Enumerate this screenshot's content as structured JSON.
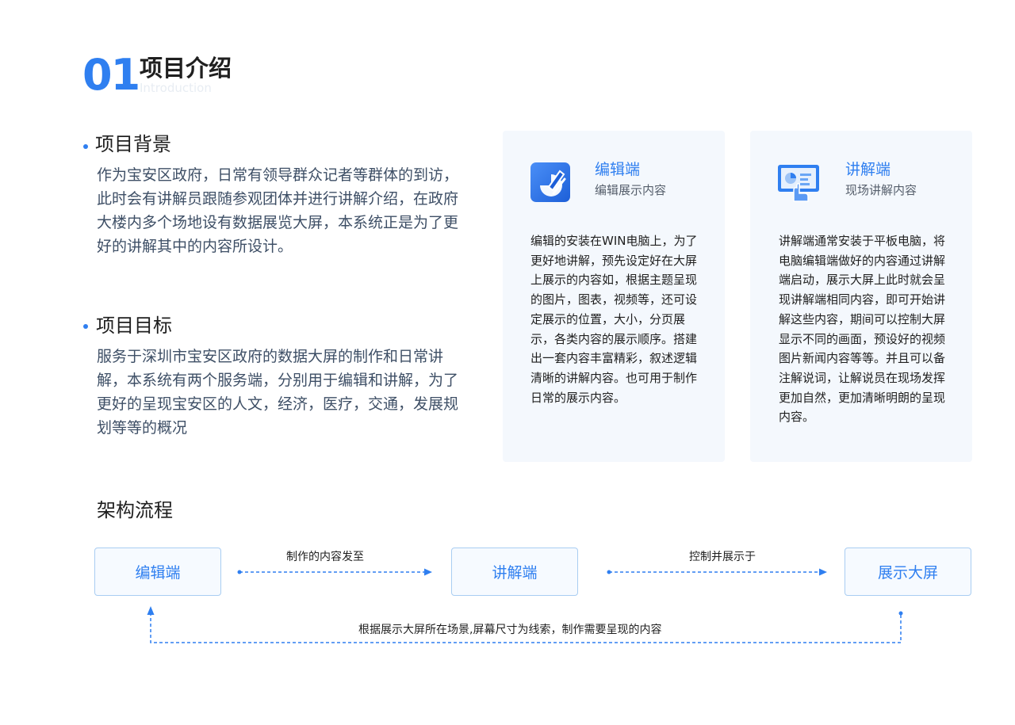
{
  "header": {
    "number": "01",
    "title": "项目介绍",
    "subtitle": "Introduction"
  },
  "background": {
    "title": "项目背景",
    "text": "作为宝安区政府，日常有领导群众记者等群体的到访，此时会有讲解员跟随参观团体并进行讲解介绍，在政府大楼内多个场地设有数据展览大屏，本系统正是为了更好的讲解其中的内容所设计。"
  },
  "goal": {
    "title": "项目目标",
    "text": "服务于深圳市宝安区政府的数据大屏的制作和日常讲解，本系统有两个服务端，分别用于编辑和讲解，为了更好的呈现宝安区的人文，经济，医疗，交通，发展规划等等的概况"
  },
  "cards": [
    {
      "icon": "edit-app-icon",
      "title": "编辑端",
      "subtitle": "编辑展示内容",
      "text": "编辑的安装在WIN电脑上，为了更好地讲解，预先设定好在大屏上展示的内容如，根据主题呈现的图片，图表，视频等，还可设定展示的位置，大小，分页展示，各类内容的展示顺序。搭建出一套内容丰富精彩，叙述逻辑清晰的讲解内容。也可用于制作日常的展示内容。"
    },
    {
      "icon": "presentation-screen-icon",
      "title": "讲解端",
      "subtitle": "现场讲解内容",
      "text": "讲解端通常安装于平板电脑，将电脑编辑端做好的内容通过讲解端启动，展示大屏上此时就会呈现讲解端相同内容，即可开始讲解这些内容，期间可以控制大屏显示不同的画面，预设好的视频图片新闻内容等等。并且可以备注解说词，让解说员在现场发挥更加自然，更加清晰明朗的呈现内容。"
    }
  ],
  "flow": {
    "title": "架构流程",
    "boxes": [
      "编辑端",
      "讲解端",
      "展示大屏"
    ],
    "arrow1_label": "制作的内容发至",
    "arrow2_label": "控制并展示于",
    "feedback_label": "根据展示大屏所在场景,屏幕尺寸为线索，制作需要呈现的内容"
  },
  "colors": {
    "accent": "#2f7ff0",
    "card_bg": "#f4f8fd",
    "box_border": "#a9cdf2"
  }
}
